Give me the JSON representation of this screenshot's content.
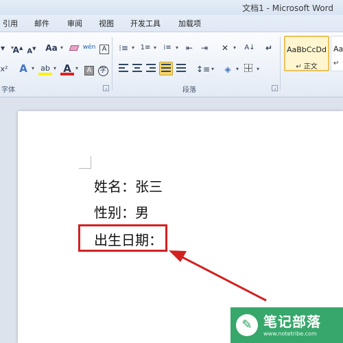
{
  "window": {
    "title": "文档1 - Microsoft Word"
  },
  "tabs": [
    "引用",
    "邮件",
    "审阅",
    "视图",
    "开发工具",
    "加载项"
  ],
  "ribbon": {
    "font_group_label": "字体",
    "paragraph_group_label": "段落",
    "font_tools": {
      "grow_font": "A",
      "shrink_font": "A",
      "change_case": "Aa",
      "phonetic": "wén",
      "char_border": "A",
      "text_effect": "A",
      "highlight": "ab",
      "font_color": "A",
      "char_shading": "A",
      "enclose": "字"
    },
    "styles": [
      {
        "sample": "AaBbCcDd",
        "name": "↵ 正文",
        "selected": true
      },
      {
        "sample": "Aa",
        "name": "↵",
        "selected": false
      }
    ]
  },
  "document": {
    "lines": [
      "姓名：张三",
      "性别：男",
      "出生日期："
    ]
  },
  "annotation": {
    "color": "#d32020"
  },
  "watermark": {
    "brand": "笔记部落",
    "url": "www.notetribe.com"
  }
}
